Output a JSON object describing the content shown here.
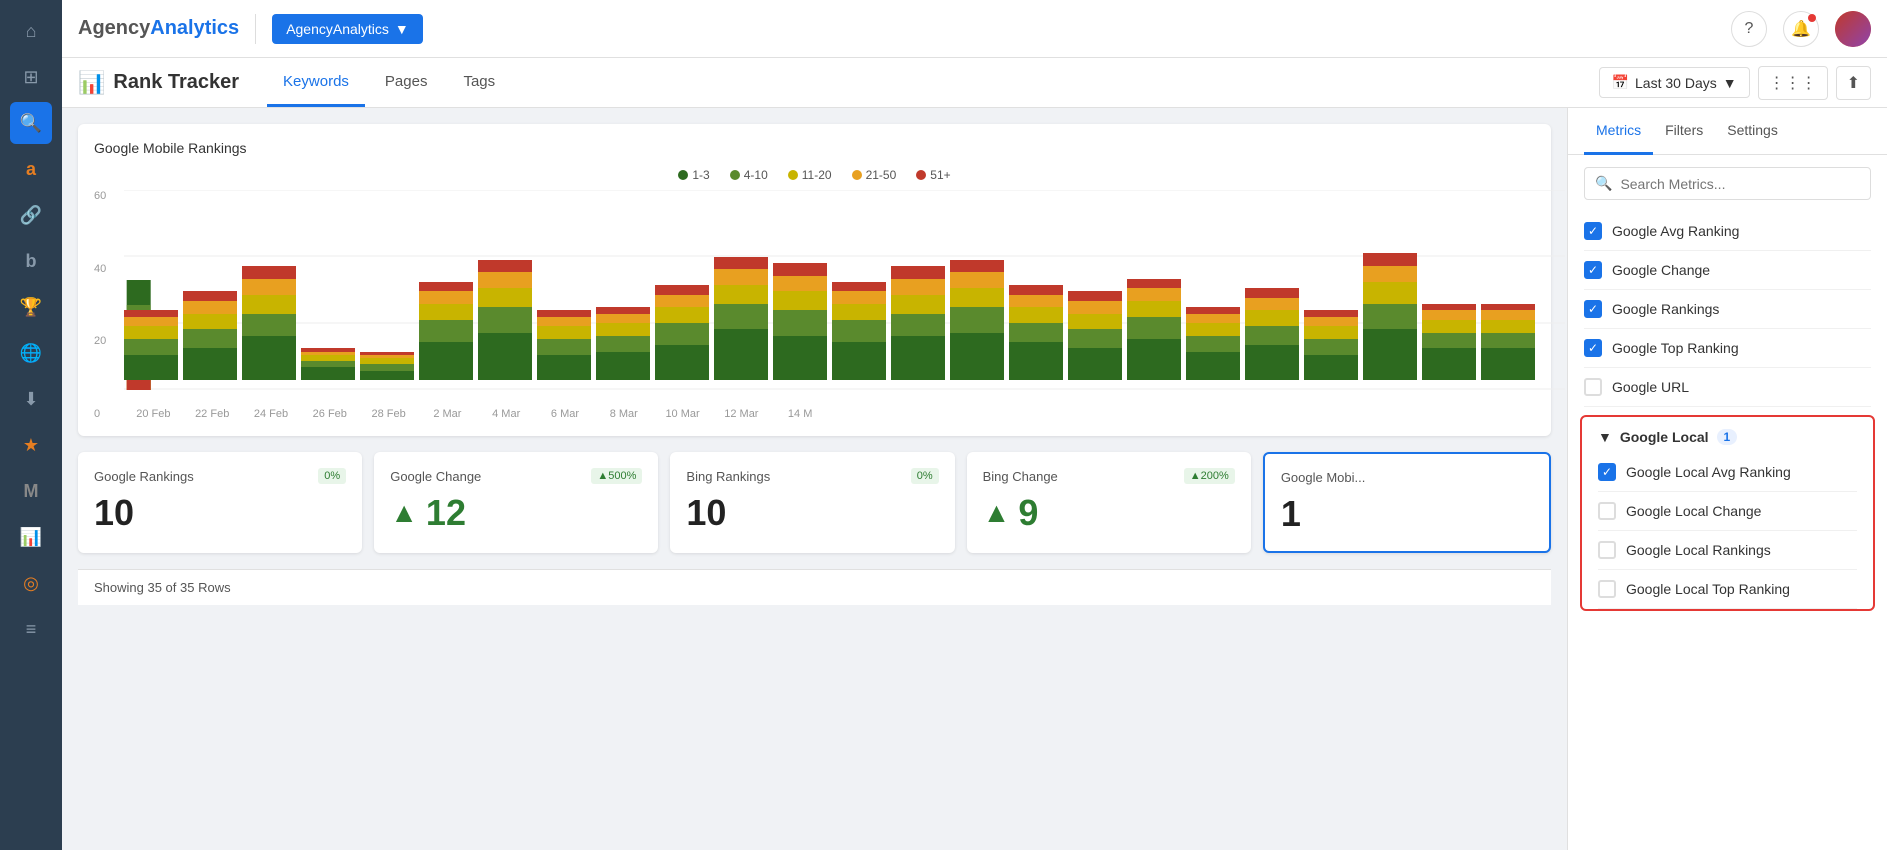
{
  "app": {
    "logo_agency": "Agency",
    "logo_analytics": "Analytics",
    "agency_btn": "AgencyAnalytics",
    "title": "Rank Tracker"
  },
  "nav_tabs": [
    {
      "label": "Keywords",
      "active": true
    },
    {
      "label": "Pages",
      "active": false
    },
    {
      "label": "Tags",
      "active": false
    }
  ],
  "date_range": "Last 30 Days",
  "chart": {
    "title": "Google Mobile Rankings",
    "legend": [
      {
        "label": "1-3",
        "color": "#2d6a1f"
      },
      {
        "label": "4-10",
        "color": "#5a8a2d"
      },
      {
        "label": "11-20",
        "color": "#c8b400"
      },
      {
        "label": "21-50",
        "color": "#e8a020"
      },
      {
        "label": "51+",
        "color": "#c0392b"
      }
    ],
    "y_labels": [
      "60",
      "40",
      "20",
      "0"
    ],
    "x_labels": [
      "20 Feb",
      "22 Feb",
      "24 Feb",
      "26 Feb",
      "28 Feb",
      "2 Mar",
      "4 Mar",
      "6 Mar",
      "8 Mar",
      "10 Mar",
      "12 Mar",
      "14 M"
    ],
    "bars": [
      [
        8,
        5,
        4,
        3,
        2
      ],
      [
        10,
        6,
        5,
        4,
        3
      ],
      [
        14,
        7,
        6,
        5,
        4
      ],
      [
        4,
        2,
        2,
        1,
        1
      ],
      [
        3,
        2,
        2,
        1,
        1
      ],
      [
        12,
        7,
        5,
        4,
        3
      ],
      [
        15,
        8,
        6,
        5,
        4
      ],
      [
        8,
        5,
        4,
        3,
        2
      ],
      [
        9,
        5,
        4,
        3,
        2
      ],
      [
        11,
        7,
        5,
        4,
        3
      ],
      [
        16,
        8,
        6,
        5,
        4
      ],
      [
        14,
        8,
        6,
        5,
        4
      ],
      [
        12,
        7,
        5,
        4,
        3
      ],
      [
        14,
        7,
        6,
        5,
        4
      ],
      [
        15,
        8,
        6,
        5,
        4
      ],
      [
        12,
        6,
        5,
        4,
        3
      ],
      [
        10,
        6,
        5,
        4,
        3
      ],
      [
        13,
        7,
        5,
        4,
        3
      ],
      [
        9,
        5,
        4,
        3,
        2
      ],
      [
        11,
        6,
        5,
        4,
        3
      ],
      [
        8,
        5,
        4,
        3,
        2
      ],
      [
        16,
        8,
        7,
        5,
        4
      ],
      [
        10,
        5,
        4,
        3,
        2
      ],
      [
        10,
        5,
        4,
        3,
        2
      ]
    ]
  },
  "metric_cards": [
    {
      "title": "Google Rankings",
      "badge": "0%",
      "badge_type": "green",
      "value": "10",
      "has_arrow": false
    },
    {
      "title": "Google Change",
      "badge": "▲500%",
      "badge_type": "green-arrow",
      "value": "12",
      "has_arrow": true
    },
    {
      "title": "Bing Rankings",
      "badge": "0%",
      "badge_type": "green",
      "value": "10",
      "has_arrow": false
    },
    {
      "title": "Bing Change",
      "badge": "▲200%",
      "badge_type": "green-arrow",
      "value": "9",
      "has_arrow": true
    },
    {
      "title": "Google Mobi...",
      "badge": "",
      "badge_type": "",
      "value": "1",
      "has_arrow": false,
      "highlighted": true
    }
  ],
  "footer": {
    "text": "Showing 35 of 35 Rows"
  },
  "right_panel": {
    "tabs": [
      "Metrics",
      "Filters",
      "Settings"
    ],
    "search_placeholder": "Search Metrics...",
    "google_section": {
      "metrics": [
        {
          "label": "Google Avg Ranking",
          "checked": true
        },
        {
          "label": "Google Change",
          "checked": true
        },
        {
          "label": "Google Rankings",
          "checked": true
        },
        {
          "label": "Google Top Ranking",
          "checked": true
        },
        {
          "label": "Google URL",
          "checked": false
        }
      ]
    },
    "google_local_section": {
      "title": "Google Local",
      "badge": "1",
      "metrics": [
        {
          "label": "Google Local Avg Ranking",
          "checked": true
        },
        {
          "label": "Google Local Change",
          "checked": false
        },
        {
          "label": "Google Local Rankings",
          "checked": false
        },
        {
          "label": "Google Local Top Ranking",
          "checked": false
        }
      ]
    }
  },
  "sidebar": {
    "icons": [
      {
        "name": "home-icon",
        "symbol": "⌂",
        "active": false
      },
      {
        "name": "grid-icon",
        "symbol": "⊞",
        "active": false
      },
      {
        "name": "search-icon",
        "symbol": "🔍",
        "active": true
      },
      {
        "name": "letter-a-icon",
        "symbol": "a",
        "active": false,
        "orange": true
      },
      {
        "name": "link-icon",
        "symbol": "⚭",
        "active": false
      },
      {
        "name": "letter-b-icon",
        "symbol": "b",
        "active": false
      },
      {
        "name": "trophy-icon",
        "symbol": "🏆",
        "active": false
      },
      {
        "name": "globe-icon",
        "symbol": "🌐",
        "active": false
      },
      {
        "name": "download-icon",
        "symbol": "⬇",
        "active": false
      },
      {
        "name": "star-icon",
        "symbol": "★",
        "active": false
      },
      {
        "name": "m-icon",
        "symbol": "M",
        "active": false
      },
      {
        "name": "chart-icon",
        "symbol": "📊",
        "active": false
      },
      {
        "name": "eye-icon",
        "symbol": "◎",
        "active": false
      },
      {
        "name": "list-icon",
        "symbol": "≡",
        "active": false
      }
    ]
  }
}
